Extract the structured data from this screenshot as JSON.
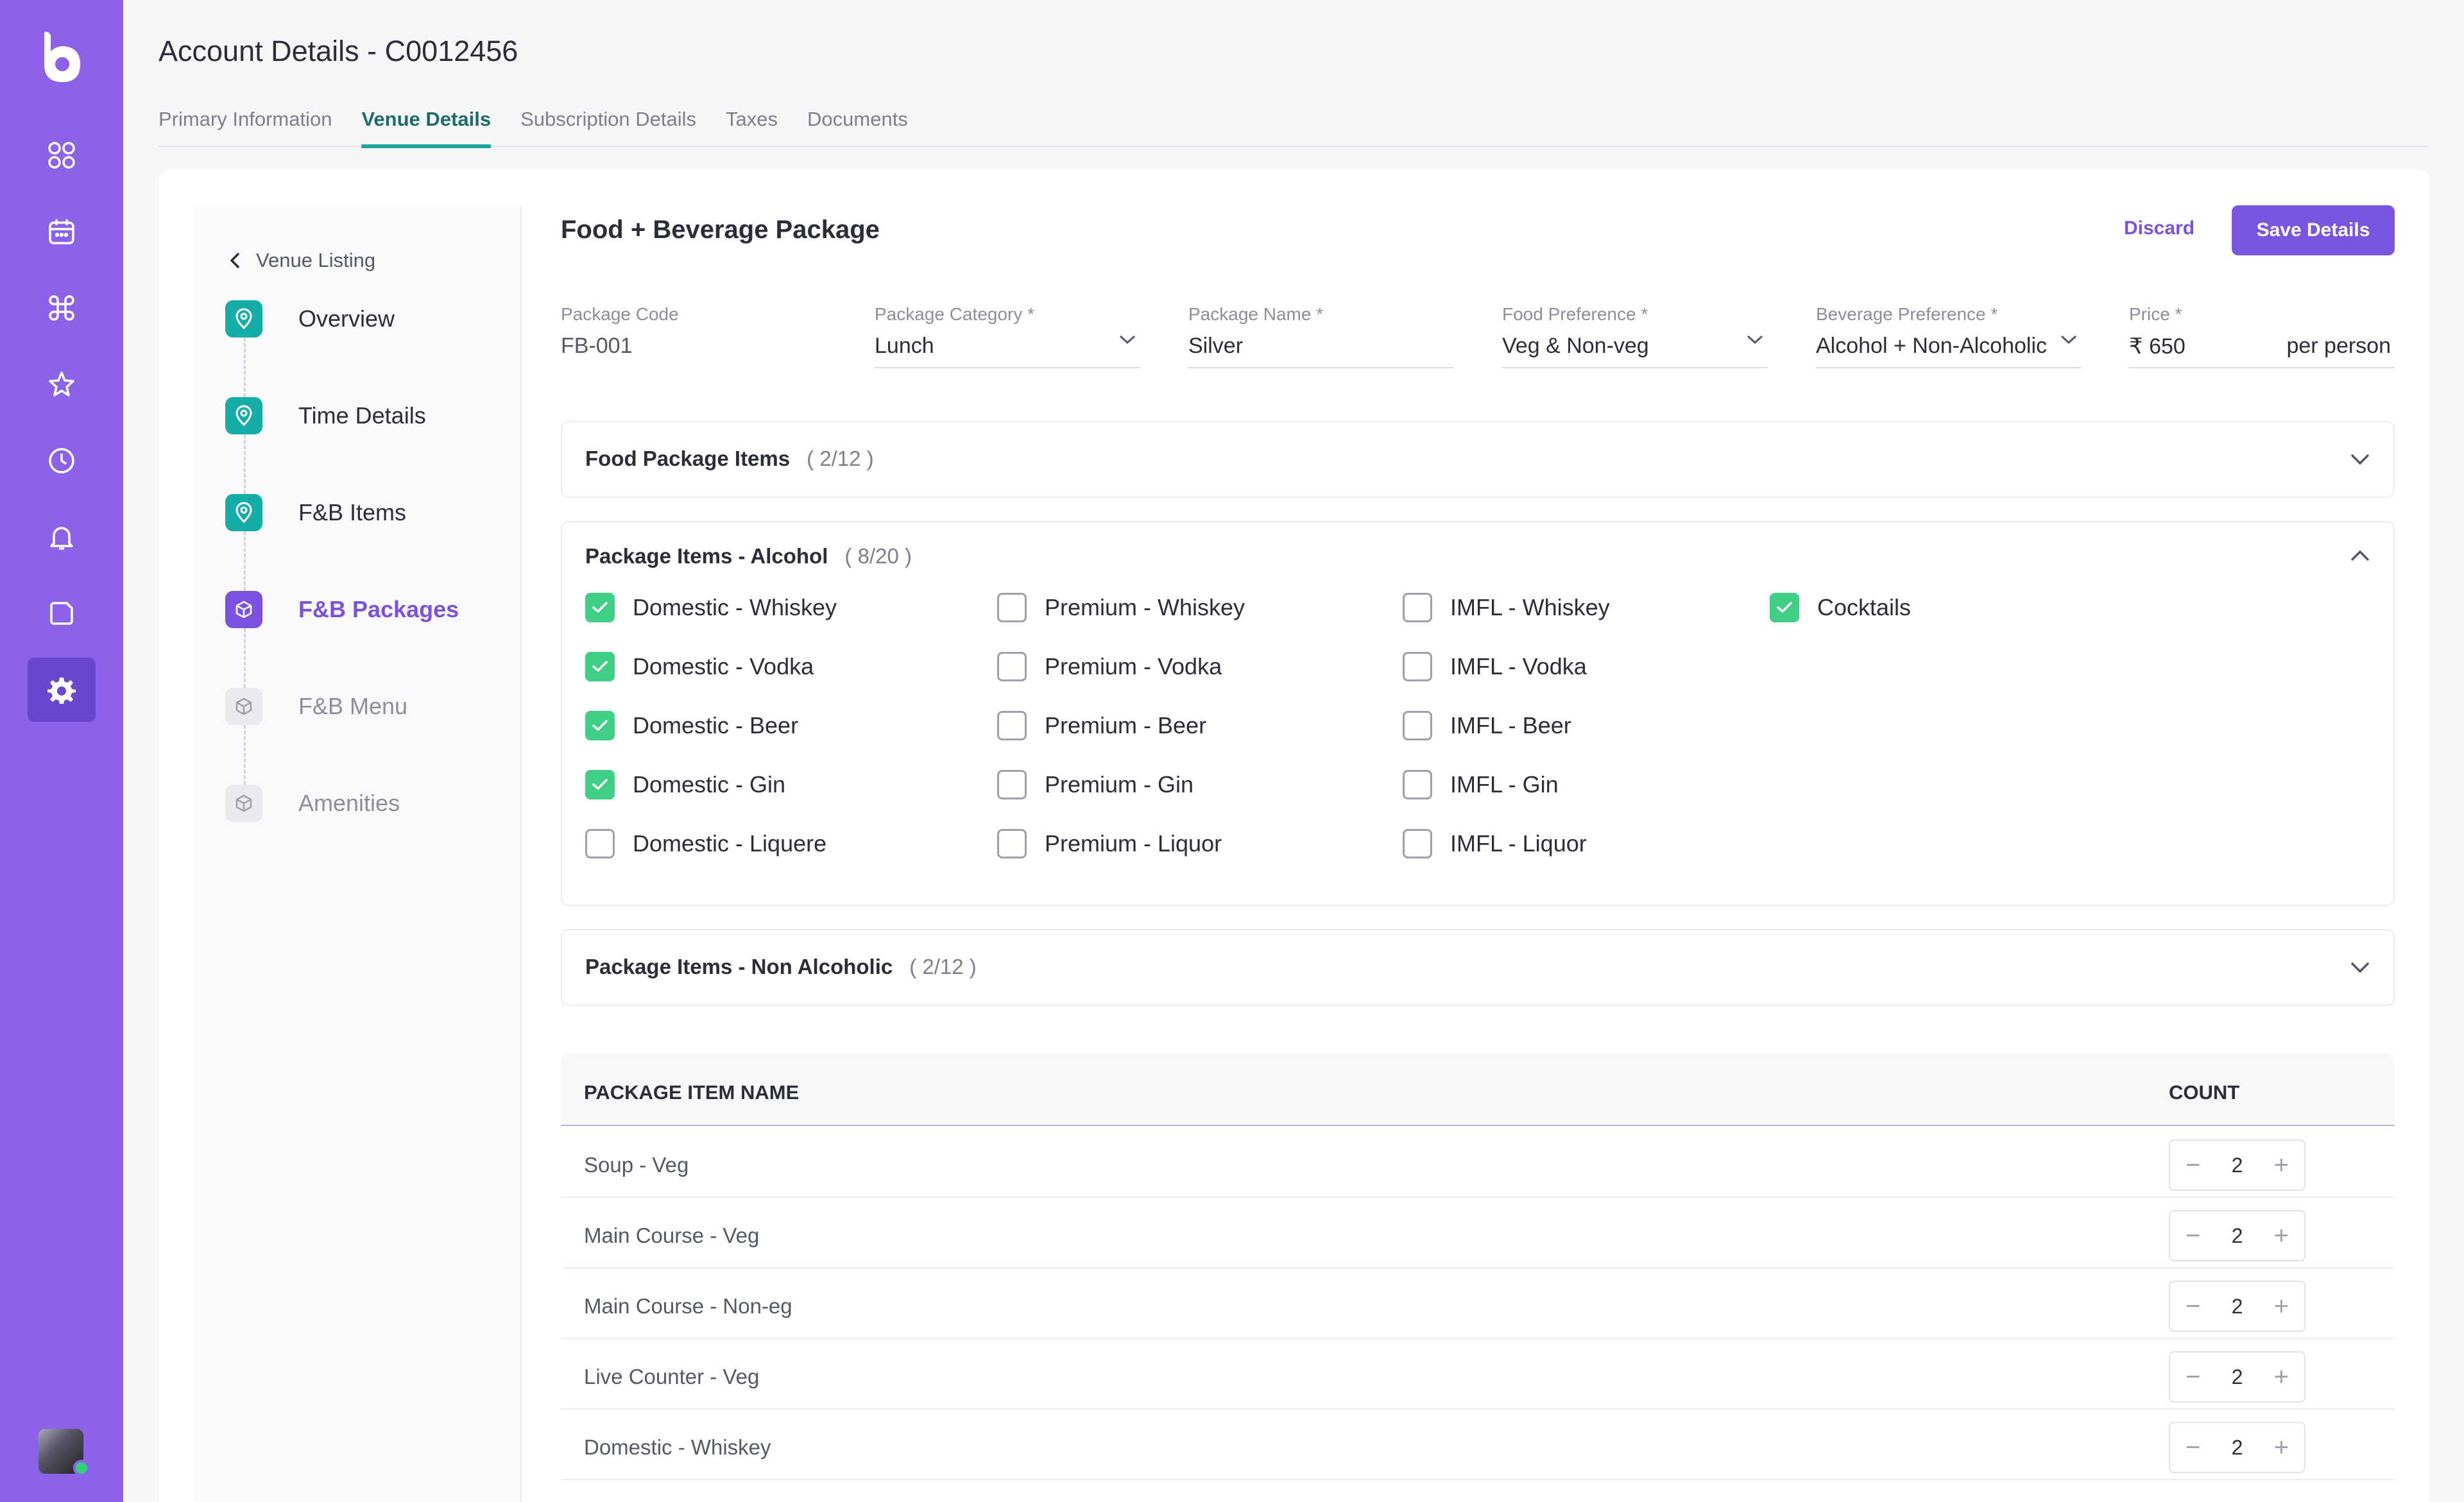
{
  "header": {
    "title": "Account Details - C0012456"
  },
  "tabs": [
    {
      "label": "Primary Information"
    },
    {
      "label": "Venue Details"
    },
    {
      "label": "Subscription Details"
    },
    {
      "label": "Taxes"
    },
    {
      "label": "Documents"
    }
  ],
  "active_tab": "Venue Details",
  "nav": {
    "back_label": "Venue Listing",
    "steps": [
      {
        "label": "Overview",
        "state": "done"
      },
      {
        "label": "Time Details",
        "state": "done"
      },
      {
        "label": "F&B Items",
        "state": "done"
      },
      {
        "label": "F&B Packages",
        "state": "current"
      },
      {
        "label": "F&B Menu",
        "state": "todo"
      },
      {
        "label": "Amenities",
        "state": "todo"
      }
    ]
  },
  "package": {
    "title": "Food + Beverage Package",
    "discard_label": "Discard",
    "save_label": "Save Details",
    "fields": [
      {
        "label": "Package Code",
        "value": "FB-001"
      },
      {
        "label": "Package Category *",
        "value": "Lunch"
      },
      {
        "label": "Package Name *",
        "value": "Silver"
      },
      {
        "label": "Food Preference *",
        "value": "Veg & Non-veg"
      },
      {
        "label": "Beverage Preference *",
        "value": "Alcohol + Non-Alcoholic"
      },
      {
        "label": "Price *",
        "value": "₹ 650",
        "suffix": "per person"
      }
    ]
  },
  "sections": [
    {
      "title": "Food Package Items",
      "count": "( 2/12 )"
    },
    {
      "title": "Package Items - Alcohol",
      "count": "( 8/20 )"
    },
    {
      "title": "Package Items - Non Alcoholic",
      "count": "( 2/12 )"
    }
  ],
  "alcohol_items": [
    [
      {
        "label": "Domestic - Whiskey",
        "checked": true
      },
      {
        "label": "Domestic - Vodka",
        "checked": true
      },
      {
        "label": "Domestic - Beer",
        "checked": true
      },
      {
        "label": "Domestic - Gin",
        "checked": true
      },
      {
        "label": "Domestic - Liquere",
        "checked": false
      }
    ],
    [
      {
        "label": "Premium - Whiskey",
        "checked": false
      },
      {
        "label": "Premium - Vodka",
        "checked": false
      },
      {
        "label": "Premium - Beer",
        "checked": false
      },
      {
        "label": "Premium - Gin",
        "checked": false
      },
      {
        "label": "Premium - Liquor",
        "checked": false
      }
    ],
    [
      {
        "label": "IMFL - Whiskey",
        "checked": false
      },
      {
        "label": "IMFL - Vodka",
        "checked": false
      },
      {
        "label": "IMFL - Beer",
        "checked": false
      },
      {
        "label": "IMFL - Gin",
        "checked": false
      },
      {
        "label": "IMFL - Liquor",
        "checked": false
      }
    ],
    [
      {
        "label": "Cocktails",
        "checked": true
      }
    ]
  ],
  "table": {
    "col_name": "PACKAGE ITEM NAME",
    "col_count": "COUNT",
    "rows": [
      {
        "name": "Soup - Veg",
        "count": "2"
      },
      {
        "name": "Main Course - Veg",
        "count": "2"
      },
      {
        "name": "Main Course - Non-eg",
        "count": "2"
      },
      {
        "name": "Live Counter - Veg",
        "count": "2"
      },
      {
        "name": "Domestic - Whiskey",
        "count": "2"
      }
    ]
  },
  "colors": {
    "rail": "#8b62e8",
    "accent": "#7a52dd",
    "teal": "#15ada8",
    "check": "#3fcf86"
  }
}
